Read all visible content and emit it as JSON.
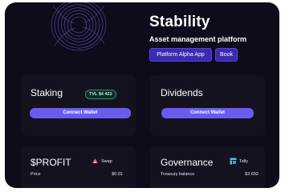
{
  "hero": {
    "title": "Stability",
    "subtitle": "Asset management platform",
    "buttons": [
      "Platform Alpha App",
      "Book"
    ]
  },
  "staking": {
    "title": "Staking",
    "tvl_badge": "TVL $4 422",
    "connect_label": "Connect Wallet"
  },
  "dividends": {
    "title": "Dividends",
    "connect_label": "Connect Wallet"
  },
  "profit": {
    "title": "$PROFIT",
    "swap_label": "Swap",
    "price_label": "Price",
    "price_value": "$0.01"
  },
  "governance": {
    "title": "Governance",
    "tally_label": "Tally",
    "treasury_label": "Treasury balance",
    "treasury_value": "$2 692"
  },
  "colors": {
    "background": "#0e0b1a",
    "card": "#15121f",
    "primary_button": "#3b2bb0",
    "connect_button": "#6a5bf0",
    "tvl_green": "#2e8f77"
  }
}
